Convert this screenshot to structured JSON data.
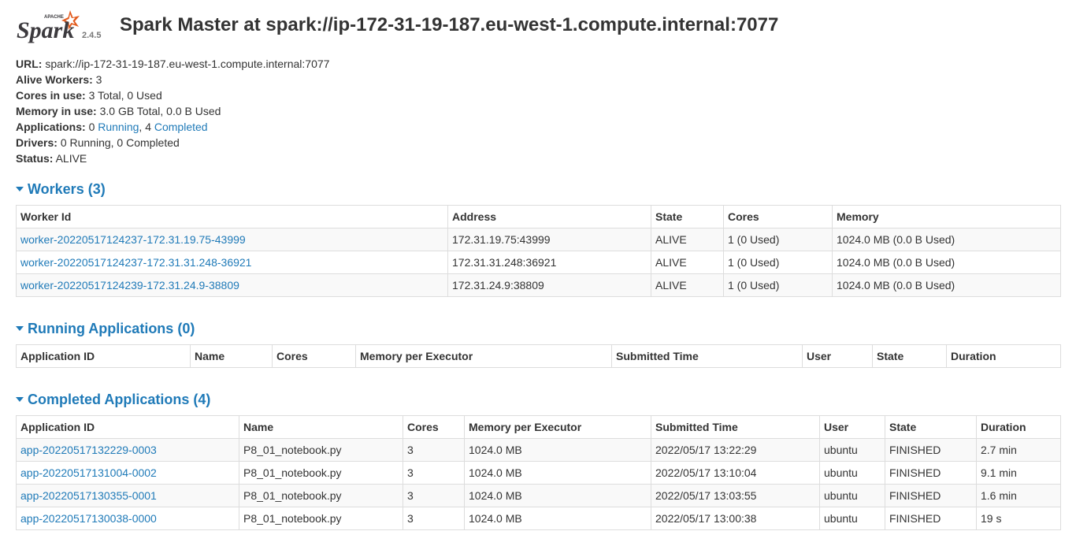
{
  "header": {
    "logo_small_text": "APACHE",
    "logo_text": "Spark",
    "version": "2.4.5",
    "title": "Spark Master at spark://ip-172-31-19-187.eu-west-1.compute.internal:7077"
  },
  "summary": {
    "url_label": "URL:",
    "url_value": "spark://ip-172-31-19-187.eu-west-1.compute.internal:7077",
    "alive_workers_label": "Alive Workers:",
    "alive_workers_value": "3",
    "cores_label": "Cores in use:",
    "cores_value": "3 Total, 0 Used",
    "memory_label": "Memory in use:",
    "memory_value": "3.0 GB Total, 0.0 B Used",
    "applications_label": "Applications:",
    "applications_running_count": "0",
    "applications_running_link": "Running",
    "applications_sep": ",",
    "applications_completed_count": "4",
    "applications_completed_link": "Completed",
    "drivers_label": "Drivers:",
    "drivers_value": "0 Running, 0 Completed",
    "status_label": "Status:",
    "status_value": "ALIVE"
  },
  "workers": {
    "heading": "Workers (3)",
    "columns": [
      "Worker Id",
      "Address",
      "State",
      "Cores",
      "Memory"
    ],
    "rows": [
      [
        "worker-20220517124237-172.31.19.75-43999",
        "172.31.19.75:43999",
        "ALIVE",
        "1 (0 Used)",
        "1024.0 MB (0.0 B Used)"
      ],
      [
        "worker-20220517124237-172.31.31.248-36921",
        "172.31.31.248:36921",
        "ALIVE",
        "1 (0 Used)",
        "1024.0 MB (0.0 B Used)"
      ],
      [
        "worker-20220517124239-172.31.24.9-38809",
        "172.31.24.9:38809",
        "ALIVE",
        "1 (0 Used)",
        "1024.0 MB (0.0 B Used)"
      ]
    ]
  },
  "running_apps": {
    "heading": "Running Applications (0)",
    "columns": [
      "Application ID",
      "Name",
      "Cores",
      "Memory per Executor",
      "Submitted Time",
      "User",
      "State",
      "Duration"
    ]
  },
  "completed_apps": {
    "heading": "Completed Applications (4)",
    "columns": [
      "Application ID",
      "Name",
      "Cores",
      "Memory per Executor",
      "Submitted Time",
      "User",
      "State",
      "Duration"
    ],
    "rows": [
      [
        "app-20220517132229-0003",
        "P8_01_notebook.py",
        "3",
        "1024.0 MB",
        "2022/05/17 13:22:29",
        "ubuntu",
        "FINISHED",
        "2.7 min"
      ],
      [
        "app-20220517131004-0002",
        "P8_01_notebook.py",
        "3",
        "1024.0 MB",
        "2022/05/17 13:10:04",
        "ubuntu",
        "FINISHED",
        "9.1 min"
      ],
      [
        "app-20220517130355-0001",
        "P8_01_notebook.py",
        "3",
        "1024.0 MB",
        "2022/05/17 13:03:55",
        "ubuntu",
        "FINISHED",
        "1.6 min"
      ],
      [
        "app-20220517130038-0000",
        "P8_01_notebook.py",
        "3",
        "1024.0 MB",
        "2022/05/17 13:00:38",
        "ubuntu",
        "FINISHED",
        "19 s"
      ]
    ]
  },
  "colors": {
    "link": "#1f7ab8",
    "logo_star": "#e25a1c",
    "logo_text": "#3c3a3e"
  }
}
